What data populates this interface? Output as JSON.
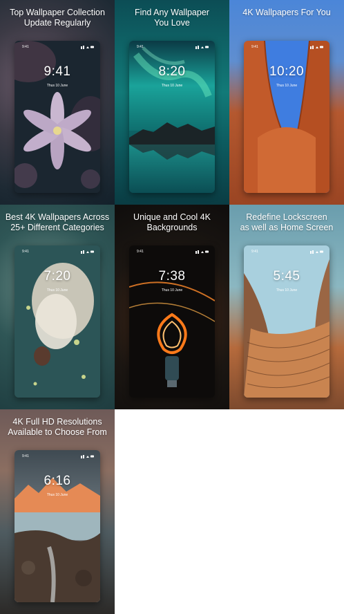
{
  "tiles": [
    {
      "caption": "Top Wallpaper Collection\nUpdate Regularly",
      "status_time": "9:41",
      "clock": "9:41",
      "date": "Thus 10 June"
    },
    {
      "caption": "Find Any Wallpaper\nYou Love",
      "status_time": "9:41",
      "clock": "8:20",
      "date": "Thus 10 June"
    },
    {
      "caption": "4K Wallpapers For You",
      "status_time": "9:41",
      "clock": "10:20",
      "date": "Thus 10 June"
    },
    {
      "caption": "Best 4K Wallpapers Across\n25+ Different Categories",
      "status_time": "9:41",
      "clock": "7:20",
      "date": "Thus 10 June"
    },
    {
      "caption": "Unique and Cool 4K\nBackgrounds",
      "status_time": "9:41",
      "clock": "7:38",
      "date": "Thus 10 June"
    },
    {
      "caption": "Redefine Lockscreen\nas well as Home Screen",
      "status_time": "9:41",
      "clock": "5:45",
      "date": "Thus 10 June"
    },
    {
      "caption": "4K Full HD Resolutions\nAvailable to Choose From",
      "status_time": "9:41",
      "clock": "6:16",
      "date": "Thus 10 June"
    }
  ]
}
